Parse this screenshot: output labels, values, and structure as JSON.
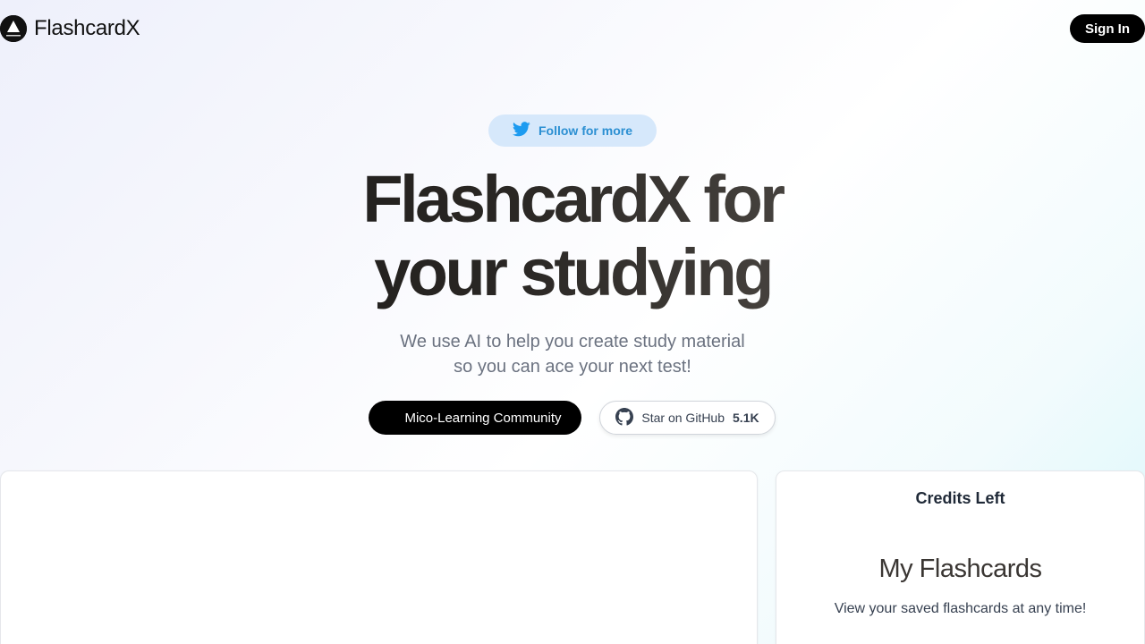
{
  "header": {
    "brand": "FlashcardX",
    "logo_icon": "triangle-logo-icon",
    "signin_label": "Sign In"
  },
  "hero": {
    "follow_label": "Follow for more",
    "follow_icon": "twitter-bird-icon",
    "headline_line1": "FlashcardX for",
    "headline_line2": "your studying",
    "subtitle": "We use AI to help you create study material so you can ace your next test!",
    "community_label": "Mico-Learning Community",
    "github_label": "Star on GitHub",
    "github_count": "5.1K",
    "github_icon": "github-icon"
  },
  "sidebar_panel": {
    "credits_title": "Credits Left",
    "flashcards_title": "My Flashcards",
    "flashcards_subtitle": "View your saved flashcards at any time!"
  },
  "colors": {
    "accent_twitter": "#1d9bf0",
    "follow_bg": "#d6e8fb",
    "primary_button": "#000000",
    "subtitle_text": "#6b7280"
  }
}
